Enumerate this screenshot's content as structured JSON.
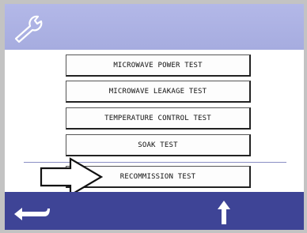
{
  "menu": {
    "items": [
      {
        "label": "MICROWAVE POWER TEST"
      },
      {
        "label": "MICROWAVE LEAKAGE TEST"
      },
      {
        "label": "TEMPERATURE CONTROL TEST"
      },
      {
        "label": "SOAK TEST"
      },
      {
        "label": "RECOMMISSION TEST"
      }
    ],
    "selected_index": 4
  },
  "icons": {
    "header": "wrench-icon",
    "pointer": "right-arrow-pointer-icon",
    "back": "back-arrow-icon",
    "up": "up-arrow-icon"
  },
  "colors": {
    "header_bg": "#aab0e2",
    "footer_bg": "#3e4496",
    "frame": "#c3c3c3"
  }
}
